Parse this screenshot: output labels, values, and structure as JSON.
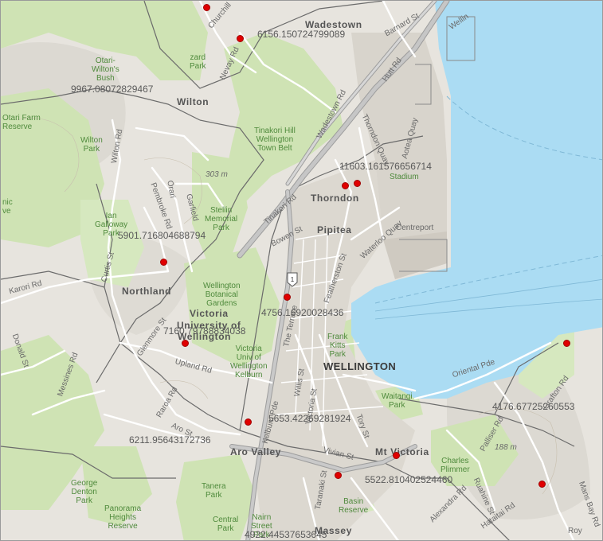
{
  "map": {
    "suburbs": {
      "wadestown": "Wadestown",
      "wilton": "Wilton",
      "thorndon": "Thorndon",
      "pipitea": "Pipitea",
      "northland": "Northland",
      "victoria": "Victoria",
      "university": "University of",
      "wellington_uni": "Wellington",
      "wellington": "WELLINGTON",
      "aro_valley": "Aro Valley",
      "mt_victoria": "Mt Victoria",
      "massey": "Massey"
    },
    "parks": {
      "otari": [
        "Otari-",
        "Wilton's",
        "Bush"
      ],
      "otari_farm": [
        "Otari Farm",
        "Reserve"
      ],
      "wilton_park": [
        "Wilton",
        "Park"
      ],
      "tinakori": [
        "Tinakori Hill",
        "Wellington",
        "Town Belt"
      ],
      "ian_galloway": [
        "Ian",
        "Galloway",
        "Park"
      ],
      "stellin": [
        "Stellin",
        "Memorial",
        "Park"
      ],
      "botanical": [
        "Wellington",
        "Botanical",
        "Gardens"
      ],
      "victoria_univ": [
        "Victoria",
        "Univ of",
        "Wellington",
        "Kelburn"
      ],
      "frank_kitts": [
        "Frank",
        "Kitts",
        "Park"
      ],
      "waitangi": [
        "Waitangi",
        "Park"
      ],
      "charles_plimmer": [
        "Charles",
        "Plimmer"
      ],
      "george_denton": [
        "George",
        "Denton",
        "Park"
      ],
      "tanera": [
        "Tanera",
        "Park"
      ],
      "panorama": [
        "Panorama",
        "Heights",
        "Reserve"
      ],
      "central_park": [
        "Central",
        "Park"
      ],
      "nairn": [
        "Nairn",
        "Street",
        "Park"
      ],
      "basin": [
        "Basin",
        "Reserve"
      ],
      "stadium": [
        "Stadium"
      ],
      "centreport": [
        "Centreport"
      ],
      "mahic": [
        "nic",
        "ve"
      ],
      "lazard": [
        "zard",
        "Park"
      ]
    },
    "roads": {
      "churchill": "Churchill",
      "barnard": "Barnard St",
      "hutt": "Hutt Rd",
      "wellington_rd": "Wellin",
      "nevay": "Nevay Rd",
      "wadestown_rd": "Wadestown Rd",
      "thorndon_quay": "Thorndon Quay",
      "aotea_quay": "Aotea Quay",
      "wilton_rd": "Wilton Rd",
      "orari": "Orari",
      "pembroke": "Pembroke Rd",
      "garfield": "Garfield",
      "tinakori_rd": "Tinakori Rd",
      "bowen": "Bowen St",
      "waterloo": "Waterloo Quay",
      "featherston": "Featherston St",
      "curtis": "Curtis St",
      "karori": "Karori Rd",
      "glenmore": "Glenmore St",
      "terrace": "The Terrace",
      "upland": "Upland Rd",
      "donald": "Donald St",
      "messines": "Messines Rd",
      "raroa": "Raroa Rd",
      "aro_st": "Aro St",
      "willis": "Willis St",
      "victoria_st": "Victoria St",
      "kelburn_pde": "Kelburn Pde",
      "tory": "Tory St",
      "vivian": "Vivian St",
      "taranaki": "Taranaki St",
      "oriental": "Oriental Pde",
      "grafton": "Grafton Rd",
      "palliser": "Palliser Rd",
      "alexandra": "Alexandra Rd",
      "hataitai": "Hataitai Rd",
      "ruahine": "Ruahine St",
      "mans_bay": "Mans Bay Rd",
      "roy": "Roy"
    },
    "elevations": {
      "e303": "303 m",
      "e188": "188 m"
    },
    "shield": "1",
    "values": {
      "v1": "6156.150724799089",
      "v2": "9967.08072829467",
      "v3": "11603.161576656714",
      "v4": "5901.716804688794",
      "v5": "4756.16920028436",
      "v6": "7160.79788834038",
      "v7": "6211.95643172736",
      "v8": "5653.42269281924",
      "v9": "5522.810402524460",
      "v10": "4176.67725260553",
      "v11": "4922.44537653645"
    },
    "colors": {
      "water": "#abdcf3",
      "land": "#e7e4de",
      "park": "#cfe3b4",
      "urban": "#dcd8d0",
      "road": "#ffffff",
      "motorway": "#b8b8b8",
      "point": "#e00000"
    }
  }
}
